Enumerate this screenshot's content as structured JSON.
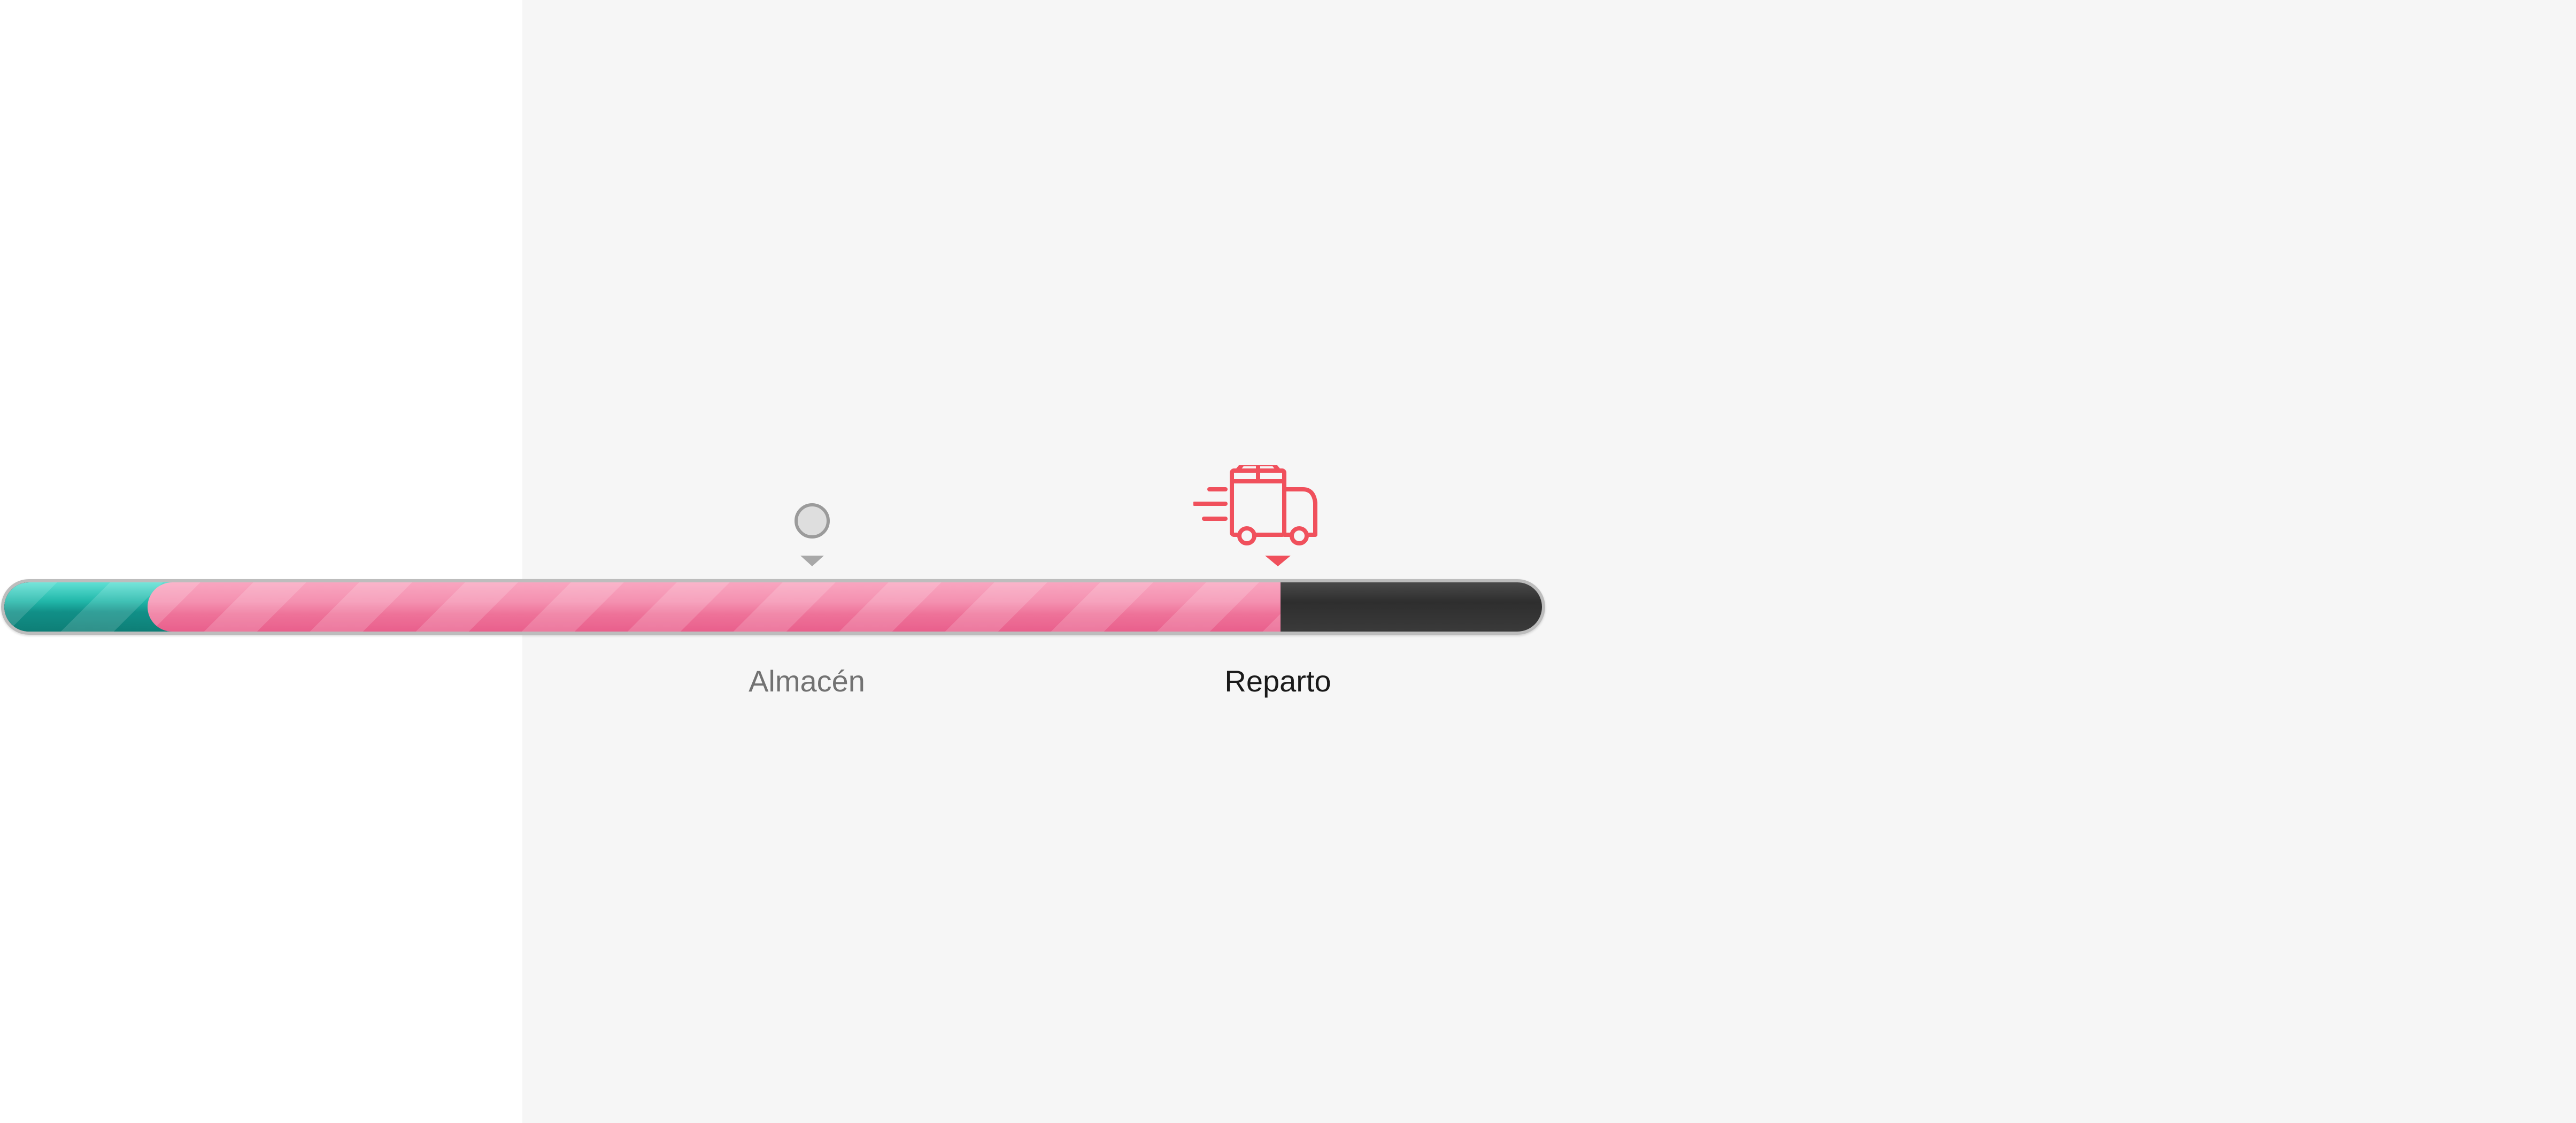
{
  "tracker": {
    "progress_fraction": 0.83,
    "completed_fraction": 0.03,
    "colors": {
      "completed": "#22b8aa",
      "in_progress": "#f490b0",
      "remaining": "#333333",
      "active_accent": "#f0505c",
      "inactive_marker": "#dedede"
    },
    "steps": [
      {
        "label": "Almacén",
        "state": "inactive",
        "icon": "circle-dot-icon"
      },
      {
        "label": "Reparto",
        "state": "active",
        "icon": "delivery-truck-icon"
      }
    ]
  }
}
